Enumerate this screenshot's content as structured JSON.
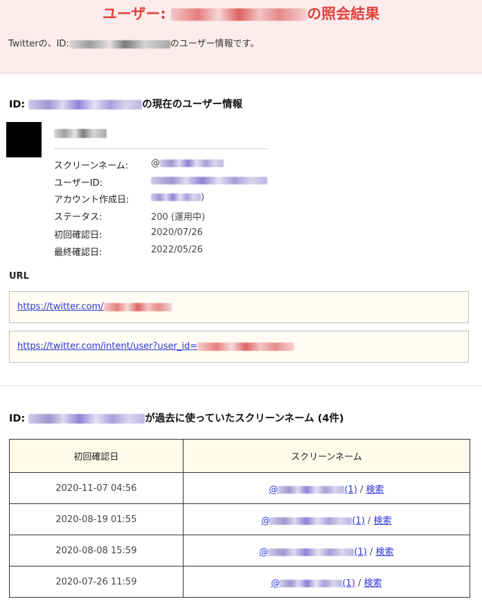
{
  "header": {
    "title_prefix": "ユーザー:",
    "title_suffix": "の照会結果",
    "sub_prefix": "Twitterの、ID:",
    "sub_suffix": "のユーザー情報です。"
  },
  "current": {
    "title_prefix": "ID:",
    "title_suffix": "の現在のユーザー情報",
    "labels": {
      "screen_name": "スクリーンネーム:",
      "user_id": "ユーザーID:",
      "created": "アカウント作成日:",
      "status": "ステータス:",
      "first_seen": "初回確認日:",
      "last_seen": "最終確認日:"
    },
    "screen_name_prefix": "@",
    "created_suffix": ")",
    "status": "200 (運用中)",
    "first_seen": "2020/07/26",
    "last_seen": "2022/05/26"
  },
  "url_section": {
    "heading": "URL",
    "url1_prefix": "https://twitter.com/",
    "url2_prefix": "https://twitter.com/intent/user?user_id="
  },
  "history": {
    "title_prefix": "ID:",
    "title_suffix": "が過去に使っていたスクリーンネーム (4件)",
    "col_date": "初回確認日",
    "col_name": "スクリーンネーム",
    "rows": [
      {
        "date": "2020-11-07 04:56",
        "at": "@",
        "count": "(1)",
        "sep": " / ",
        "search": "検索"
      },
      {
        "date": "2020-08-19 01:55",
        "at": "@",
        "count": "(1)",
        "sep": " / ",
        "search": "検索"
      },
      {
        "date": "2020-08-08 15:59",
        "at": "@",
        "count": "(1)",
        "sep": " / ",
        "search": "検索"
      },
      {
        "date": "2020-07-26 11:59",
        "at": "@",
        "count": "(1)",
        "sep": " / ",
        "search": "検索"
      }
    ]
  },
  "colors": {
    "title_red": "#e0413c",
    "header_bg": "#fdecec",
    "link": "#2b34d8",
    "box_bg": "#fffdf3"
  }
}
